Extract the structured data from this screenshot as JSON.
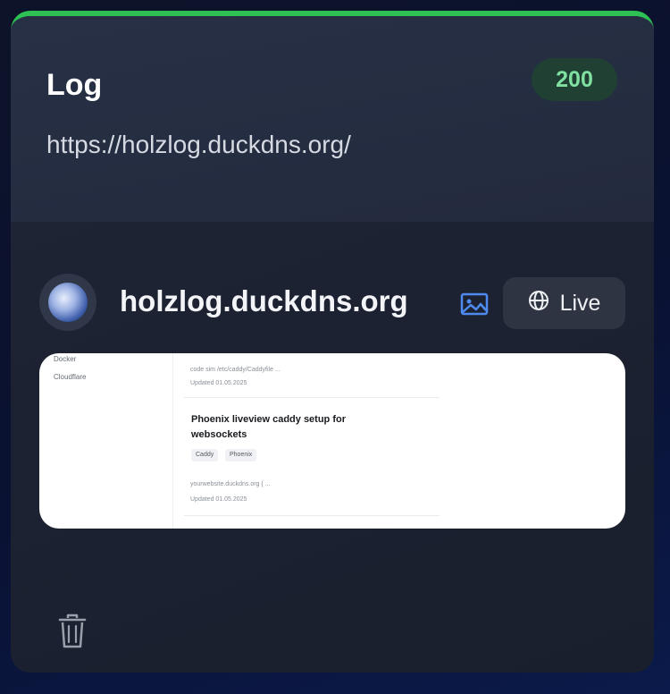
{
  "card": {
    "title": "Log",
    "status_code": "200",
    "url": "https://holzlog.duckdns.org/",
    "accent_color": "#2ec255"
  },
  "site": {
    "domain": "holzlog.duckdns.org",
    "favicon_icon": "globe-favicon",
    "image_icon": "image-icon",
    "live_label": "Live",
    "live_icon": "globe-icon"
  },
  "preview": {
    "sidebar_items": [
      "Docker",
      "Cloudflare"
    ],
    "entry1_path": "code sim /etc/caddy/Caddyfile ...",
    "entry1_updated": "Updated 01.05.2025",
    "entry2_title": "Phoenix liveview caddy setup for websockets",
    "entry2_tags": [
      "Caddy",
      "Phoenix"
    ],
    "entry2_domain": "yourwebsite.duckdns.org { ...",
    "entry2_updated": "Updated 01.05.2025"
  },
  "actions": {
    "delete_icon": "trash-icon"
  }
}
